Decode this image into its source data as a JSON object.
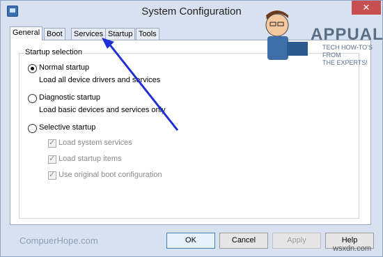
{
  "window": {
    "title": "System Configuration",
    "close_glyph": "✕"
  },
  "tabs": [
    {
      "label": "General",
      "active": true
    },
    {
      "label": "Boot"
    },
    {
      "label": "Services"
    },
    {
      "label": "Startup"
    },
    {
      "label": "Tools"
    }
  ],
  "startup": {
    "group_label": "Startup selection",
    "normal": {
      "label": "Normal startup",
      "desc": "Load all device drivers and services"
    },
    "diagnostic": {
      "label": "Diagnostic startup",
      "desc": "Load basic devices and services only"
    },
    "selective": {
      "label": "Selective startup",
      "options": [
        "Load system services",
        "Load startup items",
        "Use original boot configuration"
      ]
    }
  },
  "buttons": {
    "ok": "OK",
    "cancel": "Cancel",
    "apply": "Apply",
    "help": "Help"
  },
  "watermark": {
    "left": "CompuerHope.com",
    "right": "wsxdn.com"
  },
  "logo": {
    "name": "APPUALS",
    "tagline_1": "TECH HOW-TO'S FROM",
    "tagline_2": "THE EXPERTS!"
  },
  "colors": {
    "arrow": "#1f2fd6",
    "accent": "#3c7fb1"
  }
}
